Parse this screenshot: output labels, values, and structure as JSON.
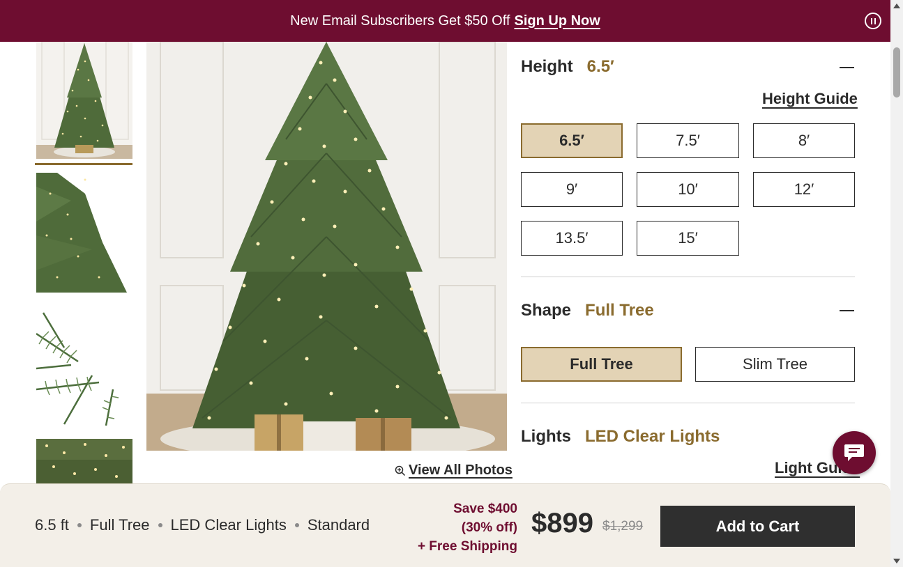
{
  "promo": {
    "text": "New Email Subscribers Get $50 Off",
    "link": "Sign Up Now"
  },
  "gallery": {
    "thumbnails": [
      "tree-full-view",
      "tree-side-view",
      "branch-closeup",
      "lights-closeup"
    ],
    "view_all": "View All Photos"
  },
  "height": {
    "label": "Height",
    "selected": "6.5′",
    "guide": "Height Guide",
    "options": [
      "6.5′",
      "7.5′",
      "8′",
      "9′",
      "10′",
      "12′",
      "13.5′",
      "15′"
    ]
  },
  "shape": {
    "label": "Shape",
    "selected": "Full Tree",
    "options": [
      "Full Tree",
      "Slim Tree"
    ]
  },
  "lights": {
    "label": "Lights",
    "selected": "LED Clear Lights",
    "guide": "Light Guide"
  },
  "summary": {
    "height": "6.5 ft",
    "shape": "Full Tree",
    "lights": "LED Clear Lights",
    "type": "Standard"
  },
  "pricing": {
    "save_line1": "Save $400",
    "save_line2": "(30% off)",
    "shipping": "+ Free Shipping",
    "price": "$899",
    "original_price": "$1,299"
  },
  "cart": {
    "label": "Add to Cart"
  },
  "colors": {
    "brand": "#6e0d30",
    "accent_gold": "#8a6b2e",
    "selected_fill": "#e3d3b5"
  }
}
